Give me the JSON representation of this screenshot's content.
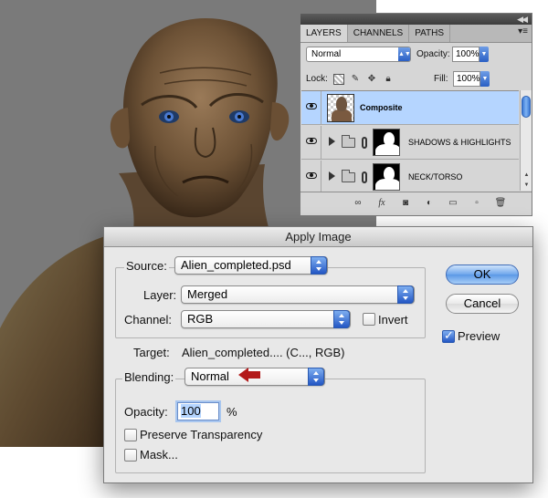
{
  "layers_panel": {
    "tabs": [
      "LAYERS",
      "CHANNELS",
      "PATHS"
    ],
    "blend_mode": "Normal",
    "opacity_label": "Opacity:",
    "opacity_value": "100%",
    "lock_label": "Lock:",
    "fill_label": "Fill:",
    "fill_value": "100%",
    "layers": [
      {
        "name": "Composite",
        "selected": true
      },
      {
        "name": "SHADOWS & HIGHLIGHTS",
        "selected": false
      },
      {
        "name": "NECK/TORSO",
        "selected": false
      }
    ]
  },
  "dialog": {
    "title": "Apply Image",
    "source_label": "Source:",
    "source_value": "Alien_completed.psd",
    "layer_label": "Layer:",
    "layer_value": "Merged",
    "channel_label": "Channel:",
    "channel_value": "RGB",
    "invert_label": "Invert",
    "target_label": "Target:",
    "target_value": "Alien_completed.... (C..., RGB)",
    "blending_label": "Blending:",
    "blending_value": "Normal",
    "opacity_label": "Opacity:",
    "opacity_value": "100",
    "opacity_unit": "%",
    "preserve_label": "Preserve Transparency",
    "mask_label": "Mask...",
    "ok_label": "OK",
    "cancel_label": "Cancel",
    "preview_label": "Preview"
  },
  "colors": {
    "selected_layer": "#b5d5ff",
    "accent_blue": "#2457c4",
    "annotation_arrow": "#b31b1b"
  }
}
